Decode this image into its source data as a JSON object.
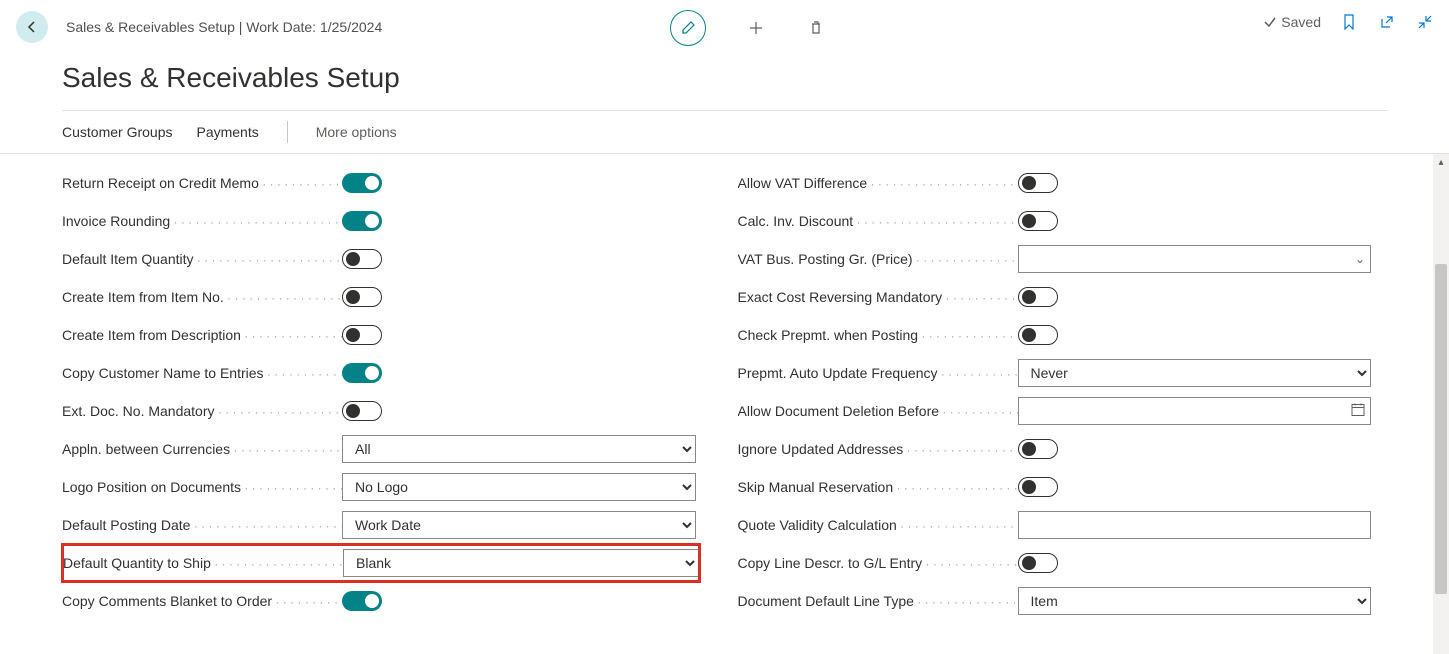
{
  "header": {
    "breadcrumb": "Sales & Receivables Setup | Work Date: 1/25/2024",
    "title": "Sales & Receivables Setup",
    "saved_label": "Saved"
  },
  "actions": {
    "customer_groups": "Customer Groups",
    "payments": "Payments",
    "more_options": "More options"
  },
  "leftFields": {
    "return_receipt": {
      "label": "Return Receipt on Credit Memo",
      "on": true
    },
    "invoice_rounding": {
      "label": "Invoice Rounding",
      "on": true
    },
    "default_item_qty": {
      "label": "Default Item Quantity",
      "on": false
    },
    "create_item_no": {
      "label": "Create Item from Item No.",
      "on": false
    },
    "create_item_desc": {
      "label": "Create Item from Description",
      "on": false
    },
    "copy_customer_name": {
      "label": "Copy Customer Name to Entries",
      "on": true
    },
    "ext_doc_no": {
      "label": "Ext. Doc. No. Mandatory",
      "on": false
    },
    "appln_currencies": {
      "label": "Appln. between Currencies",
      "value": "All"
    },
    "logo_position": {
      "label": "Logo Position on Documents",
      "value": "No Logo"
    },
    "default_posting_date": {
      "label": "Default Posting Date",
      "value": "Work Date"
    },
    "default_qty_to_ship": {
      "label": "Default Quantity to Ship",
      "value": "Blank"
    },
    "copy_comments_blanket": {
      "label": "Copy Comments Blanket to Order",
      "on": true
    }
  },
  "rightFields": {
    "allow_vat_diff": {
      "label": "Allow VAT Difference",
      "on": false
    },
    "calc_inv_discount": {
      "label": "Calc. Inv. Discount",
      "on": false
    },
    "vat_bus_posting": {
      "label": "VAT Bus. Posting Gr. (Price)",
      "value": ""
    },
    "exact_cost_reversing": {
      "label": "Exact Cost Reversing Mandatory",
      "on": false
    },
    "check_prepmt": {
      "label": "Check Prepmt. when Posting",
      "on": false
    },
    "prepmt_auto_update": {
      "label": "Prepmt. Auto Update Frequency",
      "value": "Never"
    },
    "allow_doc_deletion": {
      "label": "Allow Document Deletion Before",
      "value": ""
    },
    "ignore_updated_addr": {
      "label": "Ignore Updated Addresses",
      "on": false
    },
    "skip_manual_reservation": {
      "label": "Skip Manual Reservation",
      "on": false
    },
    "quote_validity": {
      "label": "Quote Validity Calculation",
      "value": ""
    },
    "copy_line_descr": {
      "label": "Copy Line Descr. to G/L Entry",
      "on": false
    },
    "document_default_line": {
      "label": "Document Default Line Type",
      "value": "Item"
    }
  }
}
